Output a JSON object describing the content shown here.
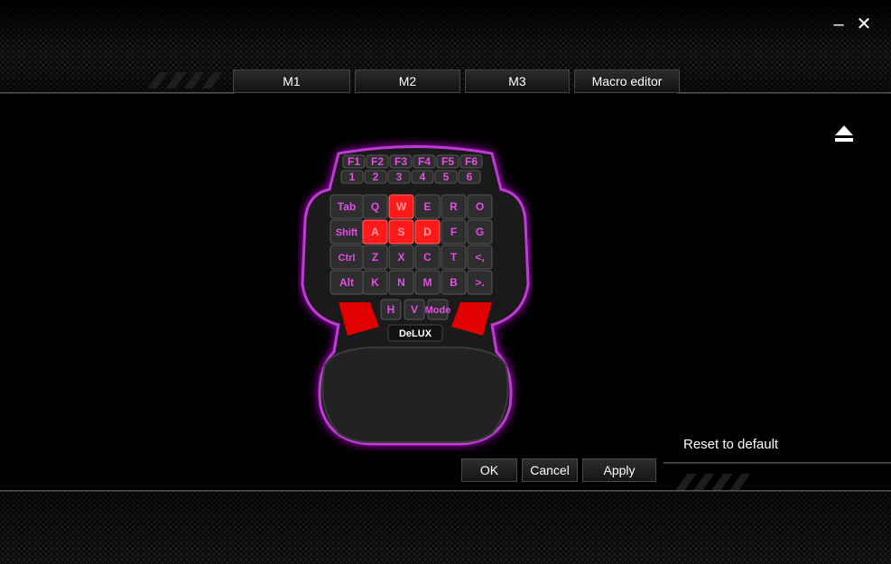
{
  "window": {
    "minimize_label": "–",
    "close_label": "✕"
  },
  "tabs": [
    {
      "label": "M1"
    },
    {
      "label": "M2"
    },
    {
      "label": "M3"
    },
    {
      "label": "Macro editor"
    }
  ],
  "device": {
    "brand": "DeLUX",
    "glow_color": "#e000ff",
    "highlight_color": "#ff1a1a",
    "fn_keys": [
      "F1",
      "F2",
      "F3",
      "F4",
      "F5",
      "F6"
    ],
    "num_keys": [
      "1",
      "2",
      "3",
      "4",
      "5",
      "6"
    ],
    "rows": [
      [
        "Tab",
        "Q",
        "W",
        "E",
        "R",
        "O"
      ],
      [
        "Shift",
        "A",
        "S",
        "D",
        "F",
        "G"
      ],
      [
        "Ctrl",
        "Z",
        "X",
        "C",
        "T",
        "<,"
      ],
      [
        "Alt",
        "K",
        "N",
        "M",
        "B",
        ">."
      ]
    ],
    "bottom_keys": [
      "H",
      "V",
      "Mode"
    ],
    "highlighted_keys": [
      "W",
      "A",
      "S",
      "D"
    ]
  },
  "actions": {
    "reset_label": "Reset to default",
    "ok_label": "OK",
    "cancel_label": "Cancel",
    "apply_label": "Apply"
  }
}
